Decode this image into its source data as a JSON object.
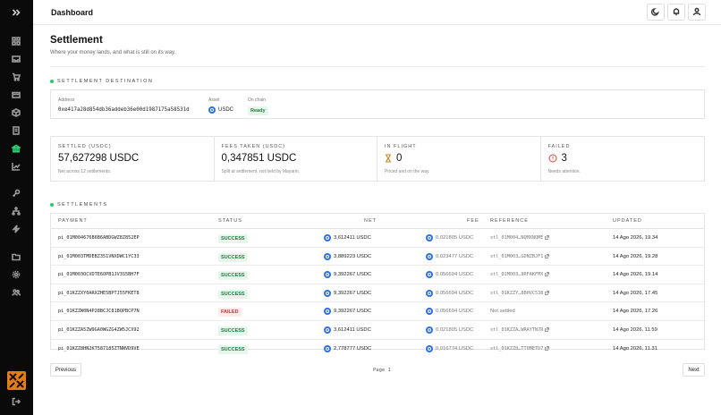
{
  "header": {
    "title": "Dashboard"
  },
  "page": {
    "title": "Settlement",
    "subtitle": "Where your money lands, and what is still on its way."
  },
  "destination": {
    "section_label": "Settlement destination",
    "address_label": "Address",
    "address": "0xe417a28d854db36addeb36e00d1987175a58531d",
    "asset_label": "Asset",
    "asset": "USDC",
    "onchain_label": "On chain",
    "onchain_status": "Ready"
  },
  "stats": [
    {
      "label": "Settled (USDC)",
      "value": "57,627298 USDC",
      "sub": "Net across 12 settlements."
    },
    {
      "label": "Fees taken (USDC)",
      "value": "0,347851 USDC",
      "sub": "Split at settlement, not held by Mayarin."
    },
    {
      "label": "In flight",
      "value": "0",
      "sub": "Priced and on the way."
    },
    {
      "label": "Failed",
      "value": "3",
      "sub": "Needs attention."
    }
  ],
  "settlements": {
    "section_label": "Settlements",
    "columns": {
      "payment": "Payment",
      "status": "Status",
      "net": "Net",
      "fee": "Fee",
      "reference": "Reference",
      "updated": "Updated"
    },
    "rows": [
      {
        "payment": "pi_01M004676B6B6ABDGWZ8Z852EP",
        "status": "SUCCESS",
        "net": "3,612411 USDC",
        "fee": "0,021805 USDC",
        "reference": "stl_01M004…NQMXNQME",
        "updated": "14 Ago 2026, 19.34"
      },
      {
        "payment": "pi_01M003TMDEBZ351VNXDWC1YC33",
        "status": "SUCCESS",
        "net": "3,889223 USDC",
        "fee": "0,023477 USDC",
        "reference": "stl_01M003…GDNZBJF1",
        "updated": "14 Ago 2026, 19.28"
      },
      {
        "payment": "pi_01M003OCVDTE6OPB1JV3S5BH7F",
        "status": "SUCCESS",
        "net": "9,392267 USDC",
        "fee": "0,056694 USDC",
        "reference": "stl_01M003…9RFAKFMX",
        "updated": "14 Ago 2026, 19.14"
      },
      {
        "payment": "pi_01KZZXY0ARXZHE5BPTJ55FKET8",
        "status": "SUCCESS",
        "net": "9,392267 USDC",
        "fee": "0,056694 USDC",
        "reference": "stl_01KZZY…8BHVC538",
        "updated": "14 Ago 2026, 17.45"
      },
      {
        "payment": "pi_01KZZW0N4P28BCJC81BQPBCP7N",
        "status": "FAILED",
        "net": "9,392267 USDC",
        "fee": "0,056694 USDC",
        "reference": "Not settled",
        "updated": "14 Ago 2026, 17.26"
      },
      {
        "payment": "pi_01KZZA5ZW9GA0WGZG4ZW5JCX92",
        "status": "SUCCESS",
        "net": "3,612411 USDC",
        "fee": "0,021805 USDC",
        "reference": "stl_01KZZA…WRAYTN7R",
        "updated": "14 Ago 2026, 11.59"
      },
      {
        "payment": "pi_01KZZ8HN2KT587185ZTNNVD9VE",
        "status": "SUCCESS",
        "net": "2,778777 USDC",
        "fee": "0,016774 USDC",
        "reference": "stl_01KZZ8…TT0METD7",
        "updated": "14 Ago 2026, 11.31"
      }
    ]
  },
  "pagination": {
    "previous": "Previous",
    "page": "Page 1",
    "next": "Next"
  },
  "colors": {
    "accent": "#2fc86b",
    "sidebar": "#0a0a0a",
    "usdc": "#2f6fdf",
    "logo": "#e27d17"
  },
  "icons": [
    "expand-icon",
    "grid-icon",
    "inbox-icon",
    "cart-icon",
    "card-icon",
    "box-icon",
    "document-icon",
    "bank-icon",
    "chart-icon",
    "key-icon",
    "network-icon",
    "bolt-icon",
    "folder-icon",
    "settings-icon",
    "team-icon",
    "logout-icon",
    "moon-icon",
    "bell-icon",
    "user-icon"
  ]
}
